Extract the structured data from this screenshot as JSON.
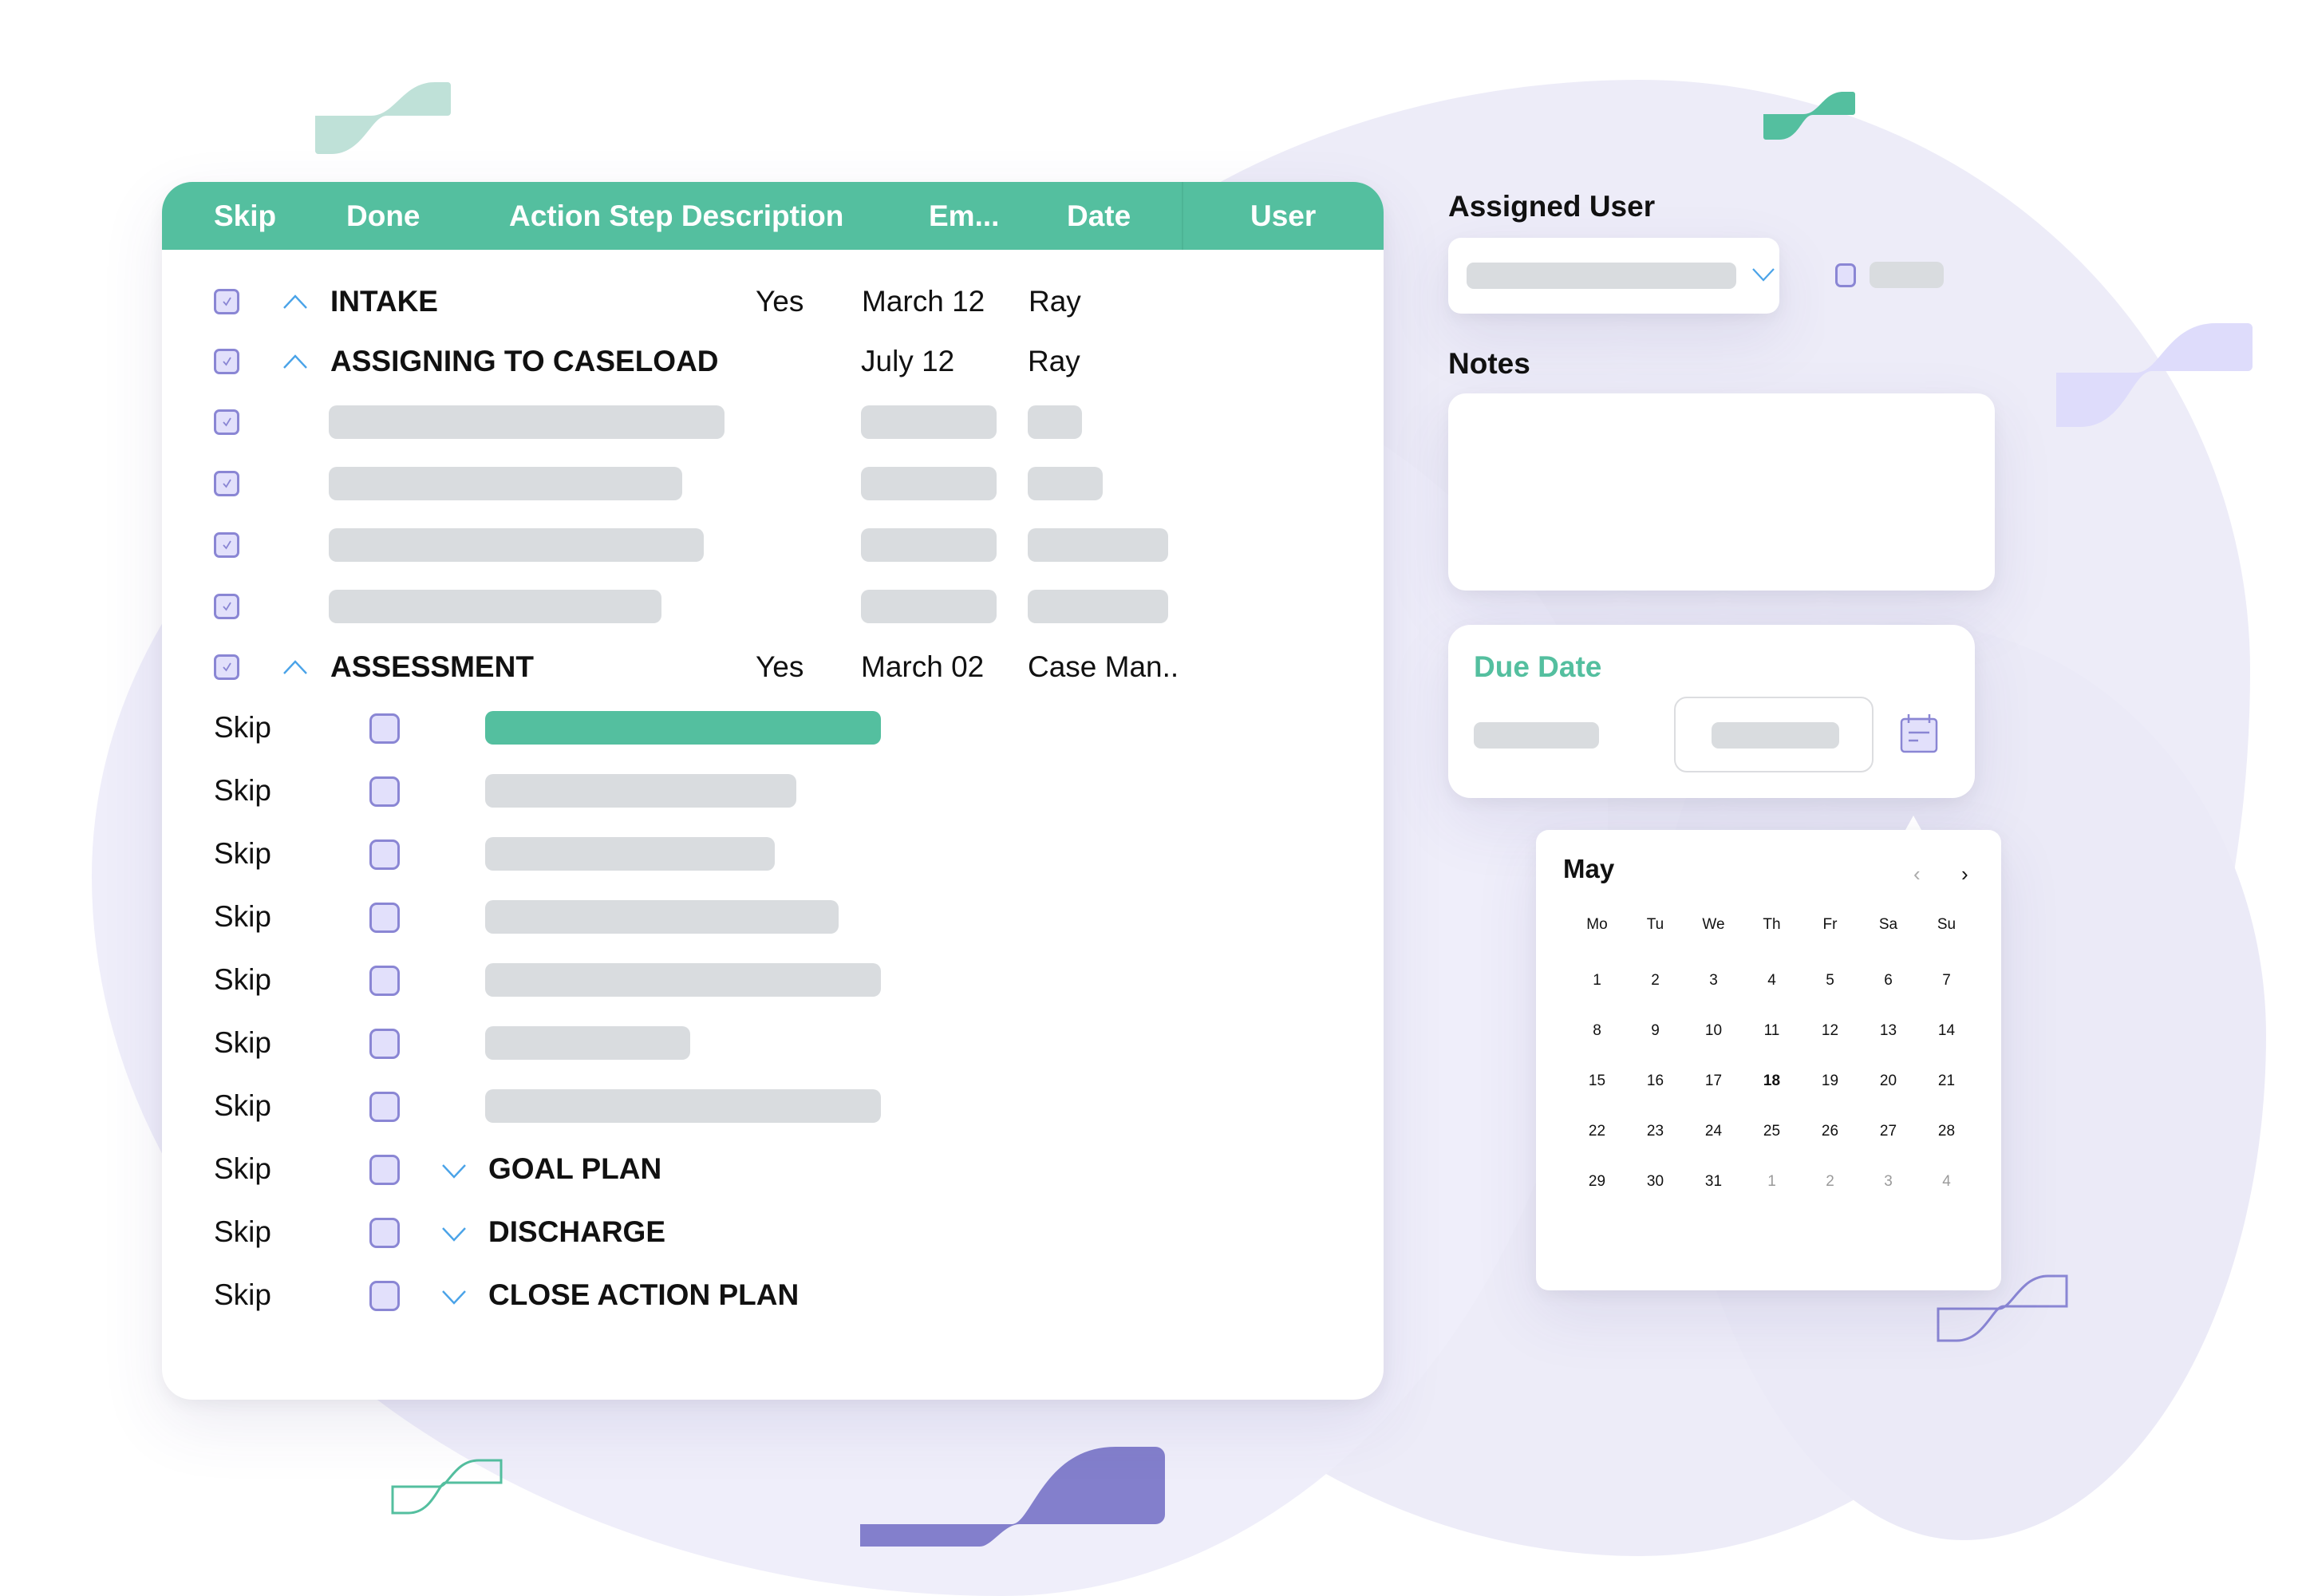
{
  "colors": {
    "accent_green": "#54bf9f",
    "accent_purple": "#8a86d4",
    "checkbox_fill": "#e2e0fb",
    "skeleton": "#d9dcdf",
    "caret_blue": "#4aa3e8"
  },
  "table": {
    "columns": [
      "Skip",
      "Done",
      "Action Step Description",
      "Em...",
      "Date",
      "User"
    ],
    "section_rows": [
      {
        "checked": true,
        "expanded": true,
        "title": "INTAKE",
        "em": "Yes",
        "date": "March 12",
        "user": "Ray"
      },
      {
        "checked": true,
        "expanded": true,
        "title": "ASSIGNING TO CASELOAD",
        "em": "",
        "date": "July 12",
        "user": "Ray"
      }
    ],
    "placeholder_rows": [
      {
        "checked": true,
        "icon": "checkbox-checked-icon"
      },
      {
        "checked": true,
        "icon": "checkbox-checked-icon"
      },
      {
        "checked": true,
        "icon": "checkbox-checked-icon"
      },
      {
        "checked": true,
        "icon": "checkbox-checked-icon"
      }
    ],
    "assessment_row": {
      "checked": true,
      "expanded": true,
      "title": "ASSESSMENT",
      "em": "Yes",
      "date": "March 02",
      "user": "Case Man.."
    },
    "sub_rows": [
      {
        "skip_label": "Skip",
        "done": false,
        "highlighted": true
      },
      {
        "skip_label": "Skip",
        "done": false
      },
      {
        "skip_label": "Skip",
        "done": false
      },
      {
        "skip_label": "Skip",
        "done": false
      },
      {
        "skip_label": "Skip",
        "done": false
      },
      {
        "skip_label": "Skip",
        "done": false
      },
      {
        "skip_label": "Skip",
        "done": false
      }
    ],
    "collapsed_sections": [
      {
        "skip_label": "Skip",
        "done": false,
        "expanded": false,
        "title": "GOAL PLAN"
      },
      {
        "skip_label": "Skip",
        "done": false,
        "expanded": false,
        "title": "DISCHARGE"
      },
      {
        "skip_label": "Skip",
        "done": false,
        "expanded": false,
        "title": "CLOSE ACTION PLAN"
      }
    ]
  },
  "assigned_user": {
    "label": "Assigned User",
    "dropdown_icon": "chevron-down-icon",
    "checkbox_checked": false
  },
  "notes": {
    "label": "Notes",
    "value": ""
  },
  "due_date": {
    "label": "Due Date",
    "calendar_icon": "calendar-icon"
  },
  "calendar": {
    "month": "May",
    "prev_icon": "chevron-left-icon",
    "next_icon": "chevron-right-icon",
    "weekdays": [
      "Mo",
      "Tu",
      "We",
      "Th",
      "Fr",
      "Sa",
      "Su"
    ],
    "weeks": [
      [
        "1",
        "2",
        "3",
        "4",
        "5",
        "6",
        "7"
      ],
      [
        "8",
        "9",
        "10",
        "11",
        "12",
        "13",
        "14"
      ],
      [
        "15",
        "16",
        "17",
        "18",
        "19",
        "20",
        "21"
      ],
      [
        "22",
        "23",
        "24",
        "25",
        "26",
        "27",
        "28"
      ],
      [
        "29",
        "30",
        "31",
        "1",
        "2",
        "3",
        "4"
      ]
    ],
    "today": "18",
    "next_month_days_in_last_week": 4
  }
}
